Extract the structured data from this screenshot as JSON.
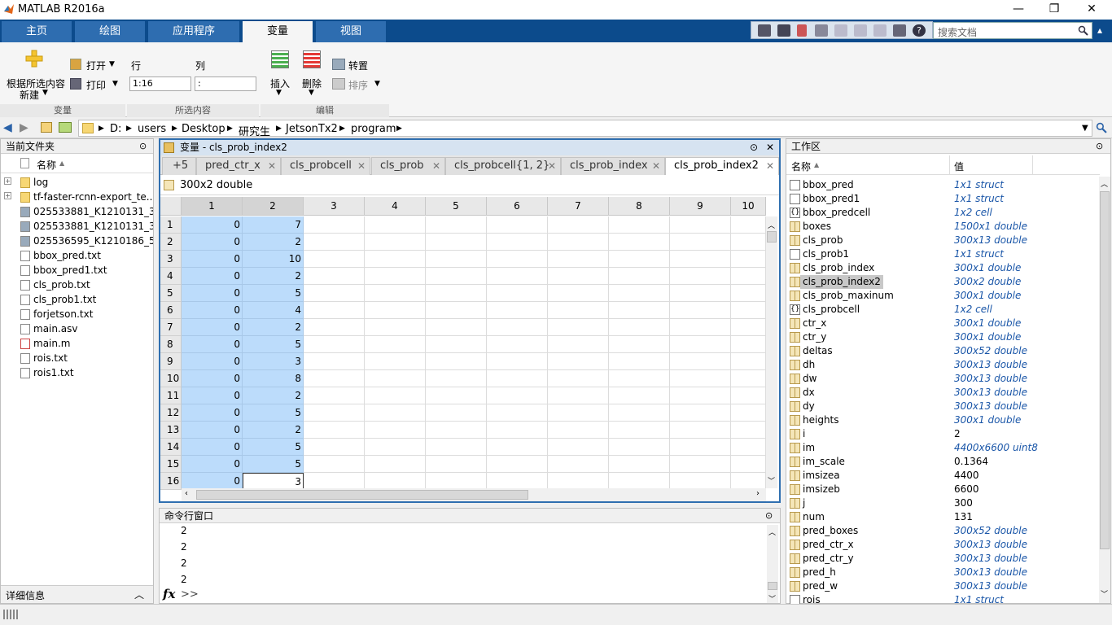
{
  "window": {
    "title": "MATLAB R2016a"
  },
  "ribbon_tabs": [
    "主页",
    "绘图",
    "应用程序",
    "变量",
    "视图"
  ],
  "search": {
    "placeholder": "搜索文档"
  },
  "ribbon": {
    "new_from_selection": "根据所选内容",
    "new_label": "新建",
    "open_label": "打开",
    "print_label": "打印",
    "rows_label": "行",
    "cols_label": "列",
    "rows_value": "1:16",
    "cols_value": ":",
    "insert_label": "插入",
    "delete_label": "删除",
    "transpose_label": "转置",
    "sort_label": "排序",
    "group_variable": "变量",
    "group_selection": "所选内容",
    "group_edit": "编辑"
  },
  "breadcrumb": [
    "D:",
    "users",
    "Desktop",
    "研究生",
    "JetsonTx2",
    "program"
  ],
  "file_panel": {
    "title": "当前文件夹",
    "column": "名称",
    "files": [
      "log",
      "tf-faster-rcnn-export_te...",
      "025533881_K1210131_3...",
      "025533881_K1210131_3...",
      "025536595_K1210186_5...",
      "bbox_pred.txt",
      "bbox_pred1.txt",
      "cls_prob.txt",
      "cls_prob1.txt",
      "forjetson.txt",
      "main.asv",
      "main.m",
      "rois.txt",
      "rois1.txt"
    ],
    "details": "详细信息"
  },
  "var_editor": {
    "title": "变量 - cls_prob_index2",
    "more_tabs": "+5",
    "tabs": [
      "pred_ctr_x",
      "cls_probcell",
      "cls_prob",
      "cls_probcell{1, 2}",
      "cls_prob_index",
      "cls_prob_index2"
    ],
    "info": "300x2 double",
    "col_headers": [
      "1",
      "2",
      "3",
      "4",
      "5",
      "6",
      "7",
      "8",
      "9",
      "10"
    ],
    "row_headers": [
      "1",
      "2",
      "3",
      "4",
      "5",
      "6",
      "7",
      "8",
      "9",
      "10",
      "11",
      "12",
      "13",
      "14",
      "15",
      "16"
    ],
    "col1": [
      "0",
      "0",
      "0",
      "0",
      "0",
      "0",
      "0",
      "0",
      "0",
      "0",
      "0",
      "0",
      "0",
      "0",
      "0",
      "0"
    ],
    "col2": [
      "7",
      "2",
      "10",
      "2",
      "5",
      "4",
      "2",
      "5",
      "3",
      "8",
      "2",
      "5",
      "2",
      "5",
      "5",
      "3"
    ]
  },
  "command_window": {
    "title": "命令行窗口",
    "lines": [
      "2",
      "2",
      "2",
      "2"
    ],
    "fx": "fx",
    "prompt": ">>"
  },
  "workspace": {
    "title": "工作区",
    "col_name": "名称",
    "col_value": "值",
    "vars": [
      {
        "name": "bbox_pred",
        "value": "1x1 struct",
        "icon": "struct"
      },
      {
        "name": "bbox_pred1",
        "value": "1x1 struct",
        "icon": "struct"
      },
      {
        "name": "bbox_predcell",
        "value": "1x2 cell",
        "icon": "cell"
      },
      {
        "name": "boxes",
        "value": "1500x1 double",
        "icon": "matrix"
      },
      {
        "name": "cls_prob",
        "value": "300x13 double",
        "icon": "matrix"
      },
      {
        "name": "cls_prob1",
        "value": "1x1 struct",
        "icon": "struct"
      },
      {
        "name": "cls_prob_index",
        "value": "300x1 double",
        "icon": "matrix"
      },
      {
        "name": "cls_prob_index2",
        "value": "300x2 double",
        "icon": "matrix"
      },
      {
        "name": "cls_prob_maxinum",
        "value": "300x1 double",
        "icon": "matrix"
      },
      {
        "name": "cls_probcell",
        "value": "1x2 cell",
        "icon": "cell"
      },
      {
        "name": "ctr_x",
        "value": "300x1 double",
        "icon": "matrix"
      },
      {
        "name": "ctr_y",
        "value": "300x1 double",
        "icon": "matrix"
      },
      {
        "name": "deltas",
        "value": "300x52 double",
        "icon": "matrix"
      },
      {
        "name": "dh",
        "value": "300x13 double",
        "icon": "matrix"
      },
      {
        "name": "dw",
        "value": "300x13 double",
        "icon": "matrix"
      },
      {
        "name": "dx",
        "value": "300x13 double",
        "icon": "matrix"
      },
      {
        "name": "dy",
        "value": "300x13 double",
        "icon": "matrix"
      },
      {
        "name": "heights",
        "value": "300x1 double",
        "icon": "matrix"
      },
      {
        "name": "i",
        "value": "2",
        "icon": "matrix"
      },
      {
        "name": "im",
        "value": "4400x6600 uint8",
        "icon": "matrix"
      },
      {
        "name": "im_scale",
        "value": "0.1364",
        "icon": "matrix"
      },
      {
        "name": "imsizea",
        "value": "4400",
        "icon": "matrix"
      },
      {
        "name": "imsizeb",
        "value": "6600",
        "icon": "matrix"
      },
      {
        "name": "j",
        "value": "300",
        "icon": "matrix"
      },
      {
        "name": "num",
        "value": "131",
        "icon": "matrix"
      },
      {
        "name": "pred_boxes",
        "value": "300x52 double",
        "icon": "matrix"
      },
      {
        "name": "pred_ctr_x",
        "value": "300x13 double",
        "icon": "matrix"
      },
      {
        "name": "pred_ctr_y",
        "value": "300x13 double",
        "icon": "matrix"
      },
      {
        "name": "pred_h",
        "value": "300x13 double",
        "icon": "matrix"
      },
      {
        "name": "pred_w",
        "value": "300x13 double",
        "icon": "matrix"
      },
      {
        "name": "rois",
        "value": "1x1 struct",
        "icon": "struct"
      }
    ]
  }
}
